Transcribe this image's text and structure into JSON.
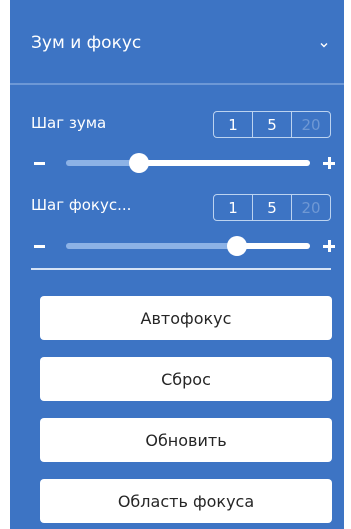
{
  "panel": {
    "title": "Зум и фокус",
    "collapse_icon": "chevron-down-icon"
  },
  "zoom_step": {
    "label": "Шаг зума",
    "options": [
      "1",
      "5",
      "20"
    ],
    "slider_value": 0.3
  },
  "focus_step": {
    "label": "Шаг фокус...",
    "options": [
      "1",
      "5",
      "20"
    ],
    "slider_value": 0.7
  },
  "buttons": {
    "autofocus": "Автофокус",
    "reset": "Сброс",
    "refresh": "Обновить",
    "focus_area": "Область фокуса"
  },
  "colors": {
    "panel_bg": "#3d74c4",
    "button_bg": "#ffffff",
    "text_light": "#ffffff",
    "text_dark": "#262626"
  }
}
